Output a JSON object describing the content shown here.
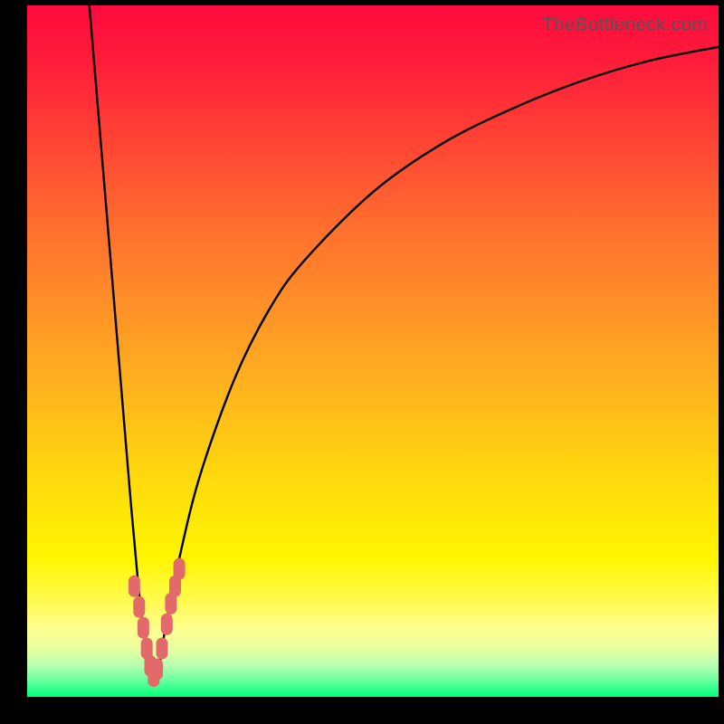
{
  "watermark": "TheBottleneck.com",
  "chart_data": {
    "type": "line",
    "title": "",
    "xlabel": "",
    "ylabel": "",
    "xlim": [
      0,
      100
    ],
    "ylim": [
      0,
      100
    ],
    "x_optimal": 18,
    "series": [
      {
        "name": "bottleneck-curve",
        "x": [
          9,
          10,
          11,
          12,
          13,
          14,
          15,
          16,
          17,
          18,
          19,
          20,
          22,
          25,
          30,
          35,
          40,
          50,
          60,
          70,
          80,
          90,
          100
        ],
        "values": [
          100,
          88,
          76,
          64,
          52,
          40,
          28,
          17,
          8,
          2,
          4,
          10,
          20,
          32,
          46,
          56,
          63,
          73,
          80,
          85,
          89,
          92,
          94
        ]
      }
    ],
    "marker_cluster": {
      "name": "highlight-points",
      "color": "#e36a6a",
      "x": [
        15.5,
        16.2,
        16.8,
        17.3,
        17.8,
        18.3,
        18.8,
        19.5,
        20.2,
        20.8,
        21.4,
        22.0
      ],
      "values": [
        16,
        13,
        10,
        7,
        4.5,
        3,
        4,
        7,
        10.5,
        13.5,
        16,
        18.5
      ]
    }
  }
}
